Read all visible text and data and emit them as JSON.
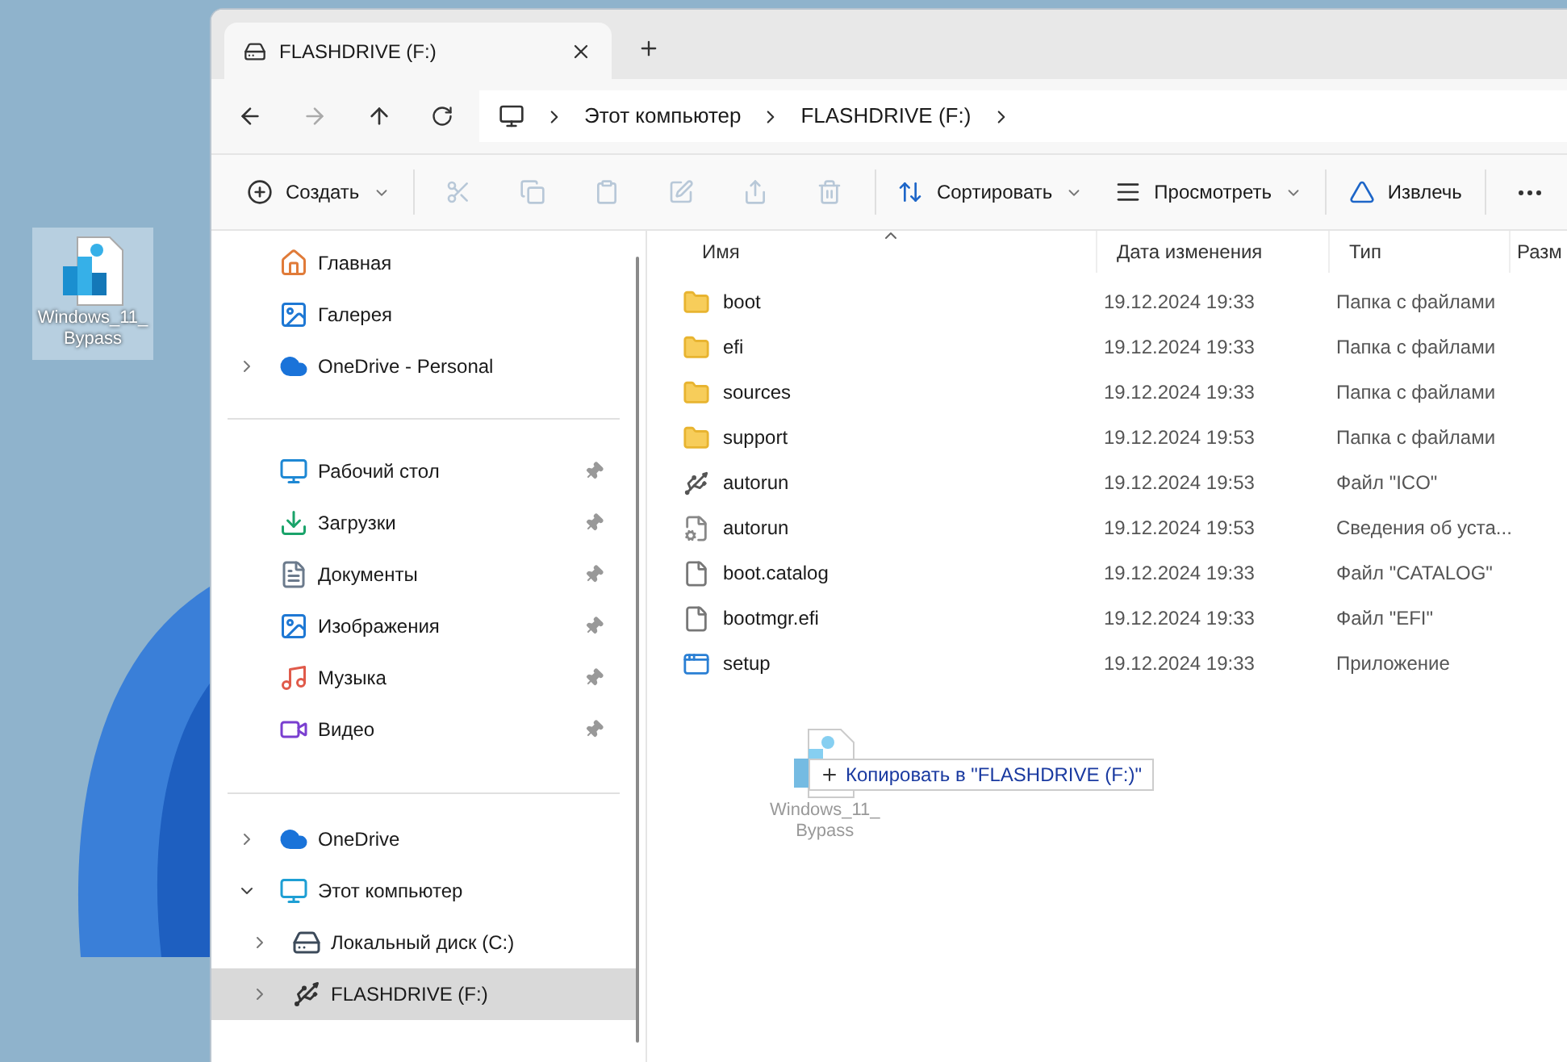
{
  "desktop_icon": {
    "label_lines": [
      "Windows_11_",
      "Bypass"
    ],
    "selected": true
  },
  "tabs": [
    {
      "label": "FLASHDRIVE (F:)",
      "selected": true
    }
  ],
  "address_bar": {
    "crumbs": [
      "Этот компьютер",
      "FLASHDRIVE (F:)"
    ]
  },
  "toolbar": [
    {
      "kind": "new",
      "label": "Создать",
      "disabled": false
    },
    {
      "kind": "cut",
      "disabled": true
    },
    {
      "kind": "copy",
      "disabled": true
    },
    {
      "kind": "paste",
      "disabled": true
    },
    {
      "kind": "rename",
      "disabled": true
    },
    {
      "kind": "share",
      "disabled": true
    },
    {
      "kind": "delete",
      "disabled": true
    },
    {
      "kind": "sort",
      "label": "Сортировать",
      "disabled": false
    },
    {
      "kind": "view",
      "label": "Просмотреть",
      "disabled": false
    },
    {
      "kind": "eject",
      "label": "Извлечь",
      "disabled": false
    },
    {
      "kind": "more",
      "disabled": false
    }
  ],
  "sidebar": {
    "sections": [
      {
        "items": [
          {
            "kind": "home",
            "label": "Главная",
            "selected": false
          },
          {
            "kind": "gallery",
            "label": "Галерея",
            "selected": false
          },
          {
            "kind": "cloud",
            "label": "OneDrive - Personal",
            "expanded": false,
            "selected": false
          }
        ]
      },
      {
        "items": [
          {
            "kind": "desktop",
            "label": "Рабочий стол",
            "pinned": true,
            "selected": false
          },
          {
            "kind": "downloads",
            "label": "Загрузки",
            "pinned": true,
            "selected": false
          },
          {
            "kind": "documents",
            "label": "Документы",
            "pinned": true,
            "selected": false
          },
          {
            "kind": "pictures",
            "label": "Изображения",
            "pinned": true,
            "selected": false
          },
          {
            "kind": "music",
            "label": "Музыка",
            "pinned": true,
            "selected": false
          },
          {
            "kind": "video",
            "label": "Видео",
            "pinned": true,
            "selected": false
          }
        ]
      },
      {
        "items": [
          {
            "kind": "cloud",
            "label": "OneDrive",
            "expanded": false,
            "selected": false
          },
          {
            "kind": "pc",
            "label": "Этот компьютер",
            "expanded": true,
            "selected": false,
            "children": [
              {
                "kind": "disk",
                "label": "Локальный диск (C:)",
                "expanded": false,
                "selected": false
              },
              {
                "kind": "usb",
                "label": "FLASHDRIVE (F:)",
                "expanded": false,
                "selected": true
              }
            ]
          }
        ]
      }
    ]
  },
  "table": {
    "columns": [
      "Имя",
      "Дата изменения",
      "Тип",
      "Разм"
    ],
    "rows": [
      {
        "kind": "folder",
        "name": "boot",
        "date": "19.12.2024 19:33",
        "type": "Папка с файлами"
      },
      {
        "kind": "folder",
        "name": "efi",
        "date": "19.12.2024 19:33",
        "type": "Папка с файлами"
      },
      {
        "kind": "folder",
        "name": "sources",
        "date": "19.12.2024 19:33",
        "type": "Папка с файлами"
      },
      {
        "kind": "folder",
        "name": "support",
        "date": "19.12.2024 19:53",
        "type": "Папка с файлами"
      },
      {
        "kind": "usb",
        "name": "autorun",
        "date": "19.12.2024 19:53",
        "type": "Файл \"ICO\""
      },
      {
        "kind": "settings",
        "name": "autorun",
        "date": "19.12.2024 19:53",
        "type": "Сведения об уста..."
      },
      {
        "kind": "file",
        "name": "boot.catalog",
        "date": "19.12.2024 19:33",
        "type": "Файл \"CATALOG\""
      },
      {
        "kind": "file",
        "name": "bootmgr.efi",
        "date": "19.12.2024 19:33",
        "type": "Файл \"EFI\""
      },
      {
        "kind": "app",
        "name": "setup",
        "date": "19.12.2024 19:33",
        "type": "Приложение"
      }
    ]
  },
  "drag": {
    "label_lines": [
      "Windows_11_",
      "Bypass"
    ],
    "tooltip": "Копировать в \"FLASHDRIVE (F:)\""
  }
}
